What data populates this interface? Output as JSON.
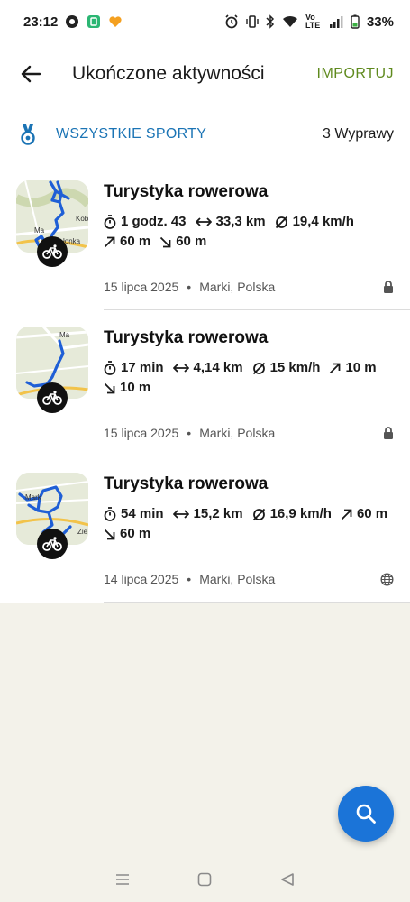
{
  "status_bar": {
    "time": "23:12",
    "battery": "33%",
    "network_label": "Vo LTE"
  },
  "header": {
    "title": "Ukończone aktywności",
    "import_label": "IMPORTUJ"
  },
  "filter": {
    "sport_label": "WSZYSTKIE SPORTY",
    "count_label": "3 Wyprawy"
  },
  "activities": [
    {
      "title": "Turystyka rowerowa",
      "duration": "1 godz. 43",
      "distance": "33,3 km",
      "avg_speed": "19,4 km/h",
      "ascent": "60 m",
      "descent": "60 m",
      "date": "15 lipca 2025",
      "location": "Marki, Polska",
      "privacy": "lock-icon"
    },
    {
      "title": "Turystyka rowerowa",
      "duration": "17 min",
      "distance": "4,14 km",
      "avg_speed": "15 km/h",
      "ascent": "10 m",
      "descent": "10 m",
      "date": "15 lipca 2025",
      "location": "Marki, Polska",
      "privacy": "lock-icon"
    },
    {
      "title": "Turystyka rowerowa",
      "duration": "54 min",
      "distance": "15,2 km",
      "avg_speed": "16,9 km/h",
      "ascent": "60 m",
      "descent": "60 m",
      "date": "14 lipca 2025",
      "location": "Marki, Polska",
      "privacy": "globe-icon"
    }
  ],
  "map_labels": {
    "a1": "Kob",
    "a2": "Ma",
    "a3": "łonka",
    "b1": "Ma",
    "c1": "Mark",
    "c2": "Zie"
  },
  "colors": {
    "accent_green": "#5f8a1e",
    "link_blue": "#1b74b5",
    "route_blue": "#1f5fd6",
    "fab_blue": "#1b74d8"
  },
  "dot": "•"
}
